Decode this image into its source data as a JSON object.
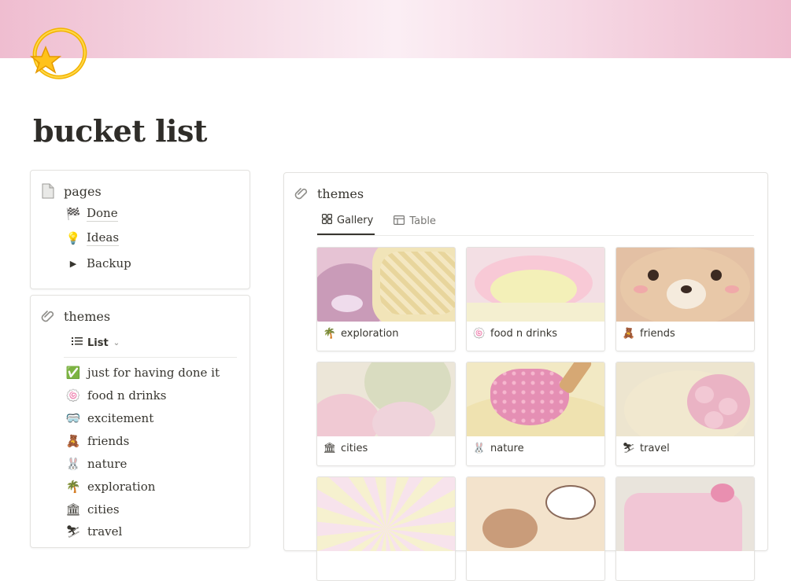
{
  "page": {
    "title": "bucket list",
    "icon": "dizzy-star-icon"
  },
  "pages_block": {
    "heading": "pages",
    "items": [
      {
        "label": "Done",
        "icon": "checkered-flag-icon",
        "glyph": "🏁"
      },
      {
        "label": "Ideas",
        "icon": "lightbulb-icon",
        "glyph": "💡"
      },
      {
        "label": "Backup",
        "icon": "toggle-arrow-icon",
        "glyph": "▶"
      }
    ]
  },
  "themes_list_block": {
    "heading": "themes",
    "view_label": "List",
    "items": [
      {
        "label": "just for having done it",
        "icon": "check-mark-icon",
        "glyph": "✅"
      },
      {
        "label": "food n drinks",
        "icon": "fish-cake-icon",
        "glyph": "🍥"
      },
      {
        "label": "excitement",
        "icon": "goggles-icon",
        "glyph": "🥽"
      },
      {
        "label": "friends",
        "icon": "teddy-bear-icon",
        "glyph": "🧸"
      },
      {
        "label": "nature",
        "icon": "rabbit-icon",
        "glyph": "🐰"
      },
      {
        "label": "exploration",
        "icon": "palm-tree-icon",
        "glyph": "🌴"
      },
      {
        "label": "cities",
        "icon": "classical-building-icon",
        "glyph": "🏛"
      },
      {
        "label": "travel",
        "icon": "skier-icon",
        "glyph": "⛷"
      }
    ]
  },
  "themes_gallery_block": {
    "heading": "themes",
    "tabs": [
      {
        "label": "Gallery",
        "icon": "gallery-grid-icon"
      },
      {
        "label": "Table",
        "icon": "table-icon"
      }
    ],
    "cards": [
      {
        "label": "exploration",
        "glyph": "🌴",
        "icon": "palm-tree-icon"
      },
      {
        "label": "food n drinks",
        "glyph": "🍥",
        "icon": "fish-cake-icon"
      },
      {
        "label": "friends",
        "glyph": "🧸",
        "icon": "teddy-bear-icon"
      },
      {
        "label": "cities",
        "glyph": "🏛",
        "icon": "classical-building-icon"
      },
      {
        "label": "nature",
        "glyph": "🐰",
        "icon": "rabbit-icon"
      },
      {
        "label": "travel",
        "glyph": "⛷",
        "icon": "skier-icon"
      },
      {
        "label": "",
        "glyph": "",
        "icon": ""
      },
      {
        "label": "",
        "glyph": "",
        "icon": ""
      },
      {
        "label": "",
        "glyph": "",
        "icon": ""
      }
    ]
  },
  "colors": {
    "cover_pink": "#efbdd0",
    "text": "#37352f",
    "border": "#e3e2df"
  }
}
